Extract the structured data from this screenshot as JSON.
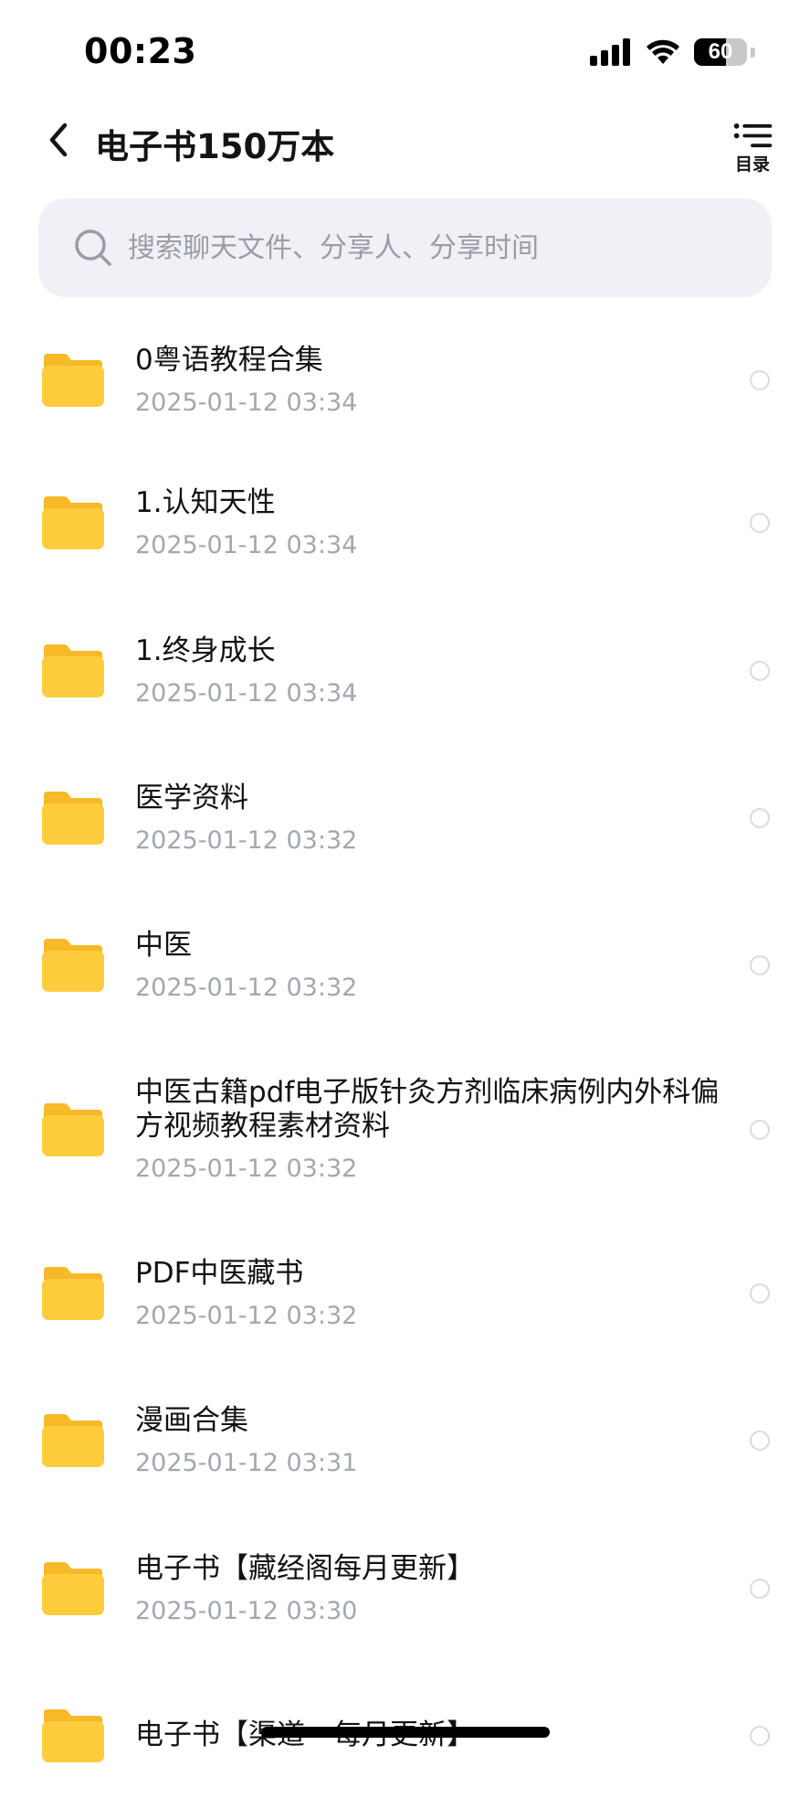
{
  "status_bar": {
    "time": "00:23",
    "battery_level": "60",
    "battery_fraction": 0.6
  },
  "header": {
    "title": "电子书150万本",
    "toc_label": "目录"
  },
  "search": {
    "placeholder": "搜索聊天文件、分享人、分享时间",
    "value": ""
  },
  "files": [
    {
      "name": "0粤语教程合集",
      "date": "2025-01-12 03:34"
    },
    {
      "name": "1.认知天性",
      "date": "2025-01-12 03:34"
    },
    {
      "name": "1.终身成长",
      "date": "2025-01-12 03:34"
    },
    {
      "name": "医学资料",
      "date": "2025-01-12 03:32"
    },
    {
      "name": "中医",
      "date": "2025-01-12 03:32"
    },
    {
      "name": "中医古籍pdf电子版针灸方剂临床病例内外科偏方视频教程素材资料",
      "date": "2025-01-12 03:32"
    },
    {
      "name": "PDF中医藏书",
      "date": "2025-01-12 03:32"
    },
    {
      "name": "漫画合集",
      "date": "2025-01-12 03:31"
    },
    {
      "name": "电子书【藏经阁每月更新】",
      "date": "2025-01-12 03:30"
    },
    {
      "name": "电子书【渠道一每月更新】",
      "date": ""
    }
  ],
  "colors": {
    "folder_yellow": "#ffcc3d",
    "folder_tab": "#f7b928",
    "search_bg": "#f0f1f6",
    "date_gray": "#a4a7b0"
  }
}
